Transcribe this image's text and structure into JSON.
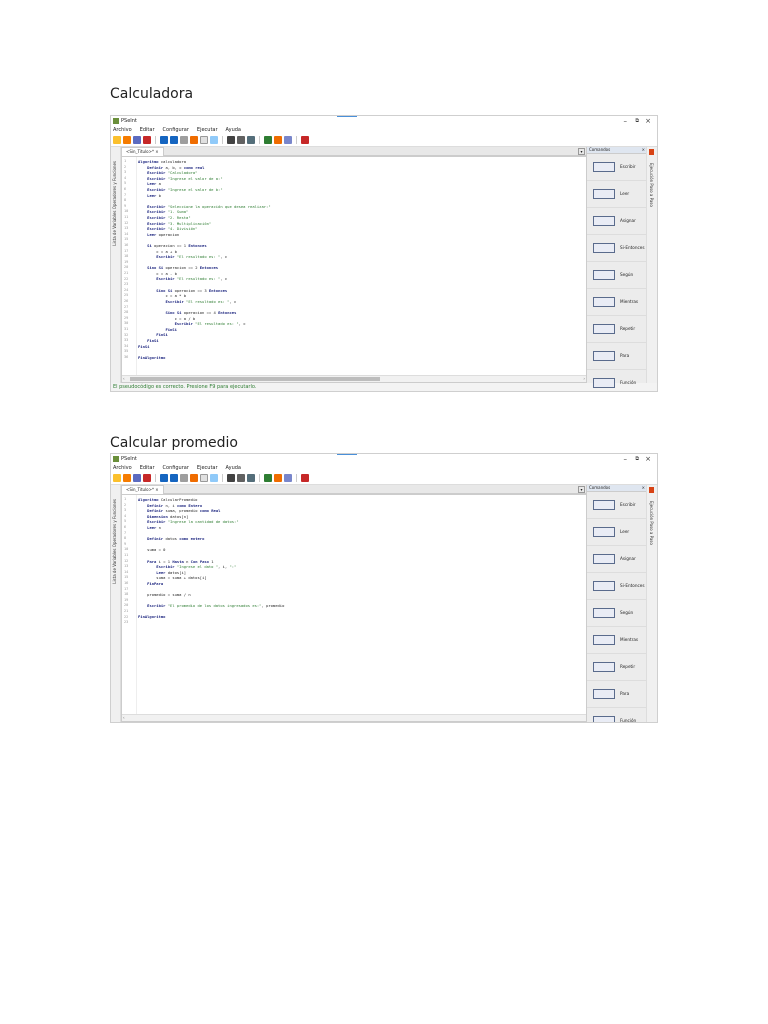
{
  "sections": [
    {
      "title": "Calculadora",
      "window": {
        "app_name": "PSeInt",
        "menu": [
          "Archivo",
          "Editar",
          "Configurar",
          "Ejecutar",
          "Ayuda"
        ],
        "tab": "<Sin_Titulo>*",
        "left_sidebar": "Lista de Variables   Operadores y Funciones",
        "right_strip": "Ejecución Paso a Paso",
        "panel_title": "Comandos",
        "commands": [
          "Escribir",
          "Leer",
          "Asignar",
          "Si-Entonces",
          "Según",
          "Mientras",
          "Repetir",
          "Para",
          "Función"
        ],
        "status": "El pseudocódigo es correcto. Presione F9 para ejecutarlo.",
        "code": [
          "Algoritmo calculadora",
          "    Definir a, b, c como real",
          "    Escribir \"Calculadora\"",
          "    Escribir \"Ingrese el valor de a:\"",
          "    Leer a",
          "    Escribir \"Ingrese el valor de b:\"",
          "    Leer b",
          "",
          "    Escribir \"Seleccione la operación que desea realizar:\"",
          "    Escribir \"1- Suma\"",
          "    Escribir \"2- Resta\"",
          "    Escribir \"3- Multiplicación\"",
          "    Escribir \"4- División\"",
          "    Leer operacion",
          "",
          "    Si operacion == 1 Entonces",
          "        c = a + b",
          "        Escribir \"El resultado es: \", c",
          "",
          "    Sino Si operacion == 2 Entonces",
          "        c = a - b",
          "        Escribir \"El resultado es: \", c",
          "",
          "        Sino Si operacion == 3 Entonces",
          "            c = a * b",
          "            Escribir \"El resultado es: \", c",
          "",
          "            Sino Si operacion == 4 Entonces",
          "                c = a / b",
          "                Escribir \"El resultado es: \", c",
          "            FinSi",
          "        FinSi",
          "    FinSi",
          "FinSi",
          "",
          "FinAlgoritmo"
        ]
      }
    },
    {
      "title": "Calcular promedio",
      "window": {
        "app_name": "PSeInt",
        "menu": [
          "Archivo",
          "Editar",
          "Configurar",
          "Ejecutar",
          "Ayuda"
        ],
        "tab": "<Sin_Titulo>*",
        "left_sidebar": "Lista de Variables   Operadores y Funciones",
        "right_strip": "Ejecución Paso a Paso",
        "panel_title": "Comandos",
        "commands": [
          "Escribir",
          "Leer",
          "Asignar",
          "Si-Entonces",
          "Según",
          "Mientras",
          "Repetir",
          "Para",
          "Función"
        ],
        "status": "",
        "code": [
          "Algoritmo CalcularPromedio",
          "    Definir n, i como Entero",
          "    Definir suma, promedio como Real",
          "    Dimension datos[n]",
          "    Escribir \"Ingrese la cantidad de datos:\"",
          "    Leer n",
          "",
          "    Definir datos como entero",
          "",
          "    suma = 0",
          "",
          "    Para i = 1 Hasta n Con Paso 1",
          "        Escribir \"Ingrese el dato \", i, \":\"",
          "        Leer datos[i]",
          "        suma = suma + datos[i]",
          "    FinPara",
          "",
          "    promedio = suma / n",
          "",
          "    Escribir \"El promedio de los datos ingresados es:\", promedio",
          "",
          "FinAlgoritmo",
          ""
        ]
      }
    }
  ]
}
